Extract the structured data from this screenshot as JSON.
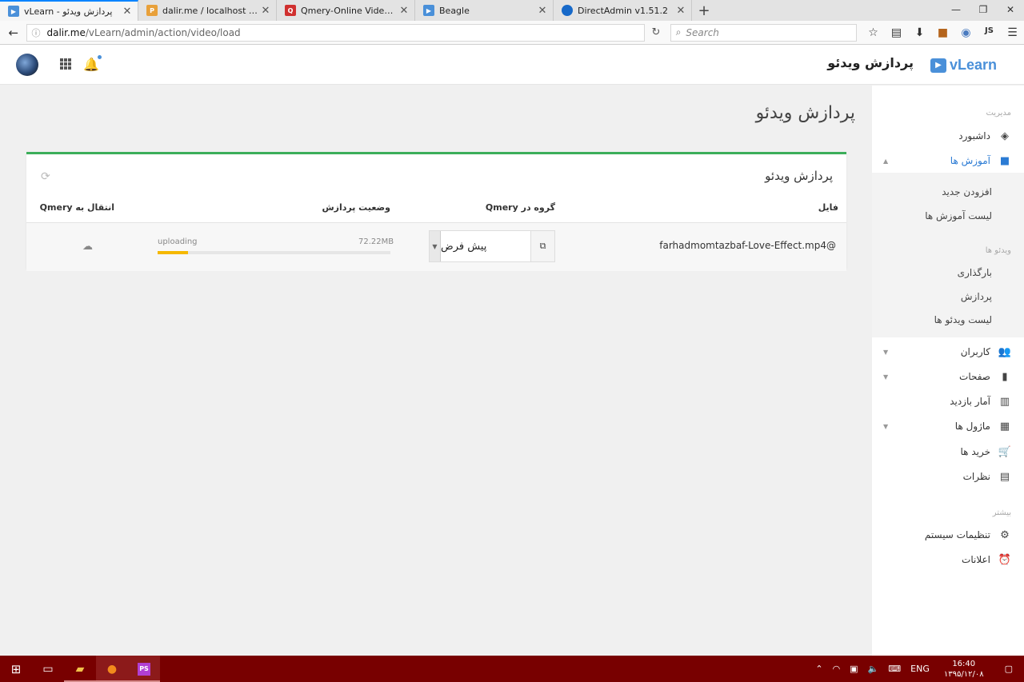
{
  "browser": {
    "tabs": [
      {
        "title": "vLearn - پردازش ویدئو",
        "favicon_color": "#4a90d9",
        "active": true
      },
      {
        "title": "dalir.me / localhost / nrpd...",
        "favicon_color": "#e8a03a",
        "active": false
      },
      {
        "title": "Qmery-Online Video Platf...",
        "favicon_color": "#d0302f",
        "active": false
      },
      {
        "title": "Beagle",
        "favicon_color": "#4a90d9",
        "active": false
      },
      {
        "title": "DirectAdmin v1.51.2",
        "favicon_color": "#1769c9",
        "active": false
      }
    ],
    "url_host": "dalir.me",
    "url_path": "/vLearn/admin/action/video/load",
    "search_placeholder": "Search",
    "toolbar_js": "JS"
  },
  "header": {
    "brand": "vLearn",
    "title": "پردازش ویدئو"
  },
  "sidebar": {
    "section_admin": "مدیریت",
    "dashboard": "داشبورد",
    "courses": "آموزش ها",
    "courses_sub": [
      "افزودن جدید",
      "لیست آموزش ها"
    ],
    "section_videos": "ویدئو ها",
    "videos_sub": [
      "بارگذاری",
      "پردازش",
      "لیست ویدئو ها"
    ],
    "users": "کاربران",
    "pages": "صفحات",
    "stats": "آمار بازدید",
    "modules": "ماژول ها",
    "purchases": "خرید ها",
    "comments": "نظرات",
    "section_more": "بیشتر",
    "settings": "تنظیمات سیستم",
    "notifications": "اعلانات"
  },
  "main": {
    "page_title": "پردازش ویدئو",
    "card_title": "پردازش ویدئو",
    "columns": {
      "file": "فایل",
      "group": "گروه در Qmery",
      "status": "وضعیت پردازش",
      "transfer": "انتقال به Qmery"
    },
    "rows": [
      {
        "file": "farhadmomtazbaf-Love-Effect.mp4@",
        "group": "پیش فرض",
        "status": "uploading",
        "size": "72.22MB",
        "progress": 0.13
      }
    ]
  },
  "taskbar": {
    "lang": "ENG",
    "time": "16:40",
    "date": "۱۳۹۵/۱۲/۰۸"
  }
}
